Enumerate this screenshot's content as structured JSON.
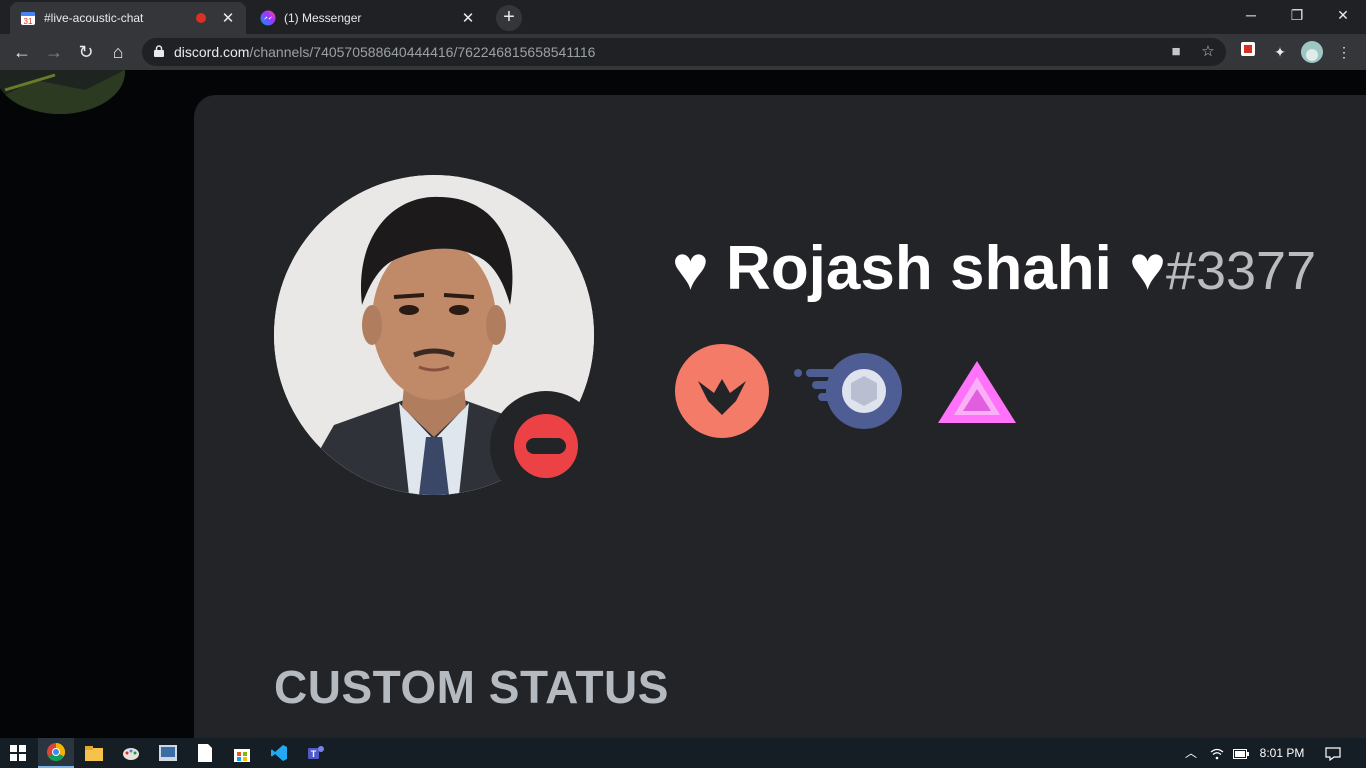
{
  "browser": {
    "tabs": [
      {
        "title": "#live-acoustic-chat",
        "favicon": "calendar-31-icon",
        "favicon_text": "31",
        "recording": true
      },
      {
        "title": "(1) Messenger",
        "favicon": "messenger-icon"
      }
    ],
    "url_host": "discord.com",
    "url_path": "/channels/740570588640444416/762246815658541116"
  },
  "profile": {
    "display_name": "♥ Rojash shahi ♥",
    "discriminator": "#3377",
    "status": "do-not-disturb",
    "status_color": "#ed4245",
    "badges": [
      "hypesquad-brilliance-badge",
      "early-supporter-nitro-badge",
      "boost-badge"
    ],
    "custom_status_title": "CUSTOM STATUS"
  },
  "taskbar": {
    "clock": "8:01 PM",
    "apps": [
      "windows-start-icon",
      "chrome-icon",
      "file-explorer-icon",
      "paint-icon",
      "media-icon",
      "notepad-icon",
      "store-icon",
      "vscode-icon",
      "teams-icon"
    ]
  },
  "colors": {
    "card_bg": "#232428",
    "page_bg": "#040507",
    "hypesquad": "#f47b67",
    "nitro": "#4e5d94",
    "boost": "#ff73fa"
  }
}
